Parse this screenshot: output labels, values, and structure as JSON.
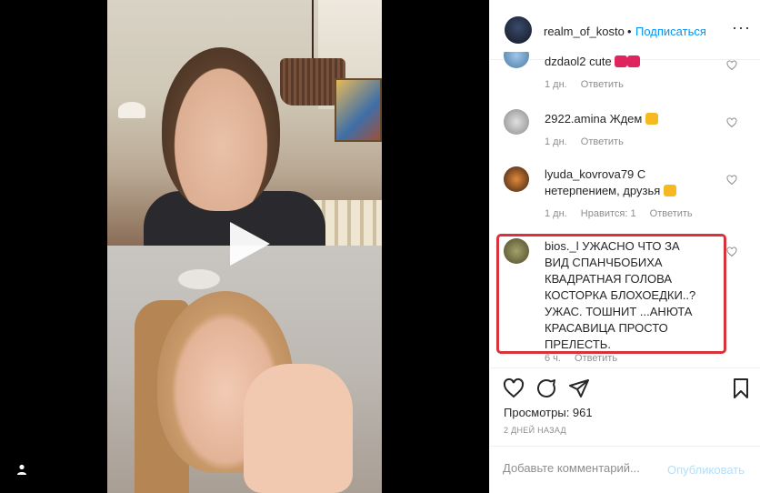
{
  "post": {
    "username": "realm_of_kosto",
    "separator": "•",
    "follow_label": "Подписаться",
    "more_label": "···"
  },
  "comments": [
    {
      "user": "dzdaol2",
      "text": "cute",
      "age": "1 дн.",
      "likes": "",
      "reply": "Ответить",
      "emoji_color": "#e0245e"
    },
    {
      "user": "2922.amina",
      "text": "Ждем",
      "age": "1 дн.",
      "likes": "",
      "reply": "Ответить",
      "emoji_color": "#f5b921"
    },
    {
      "user": "lyuda_kovrova79",
      "text": "С нетерпением, друзья",
      "age": "1 дн.",
      "likes": "Нравится: 1",
      "reply": "Ответить",
      "emoji_color": "#f5b921"
    },
    {
      "user": "bios._l",
      "text": "УЖАСНО ЧТО ЗА ВИД СПАНЧБОБИХА КВАДРАТНАЯ ГОЛОВА КОСТОРКА БЛОХОЕДКИ..? УЖАС. ТОШНИТ ...АНЮТА КРАСАВИЦА ПРОСТО ПРЕЛЕСТЬ.",
      "age": "6 ч.",
      "likes": "",
      "reply": "Ответить"
    }
  ],
  "footer": {
    "views": "Просмотры: 961",
    "date": "2 ДНЕЙ НАЗАД",
    "add_comment_placeholder": "Добавьте комментарий...",
    "publish_label": "Опубликовать"
  },
  "colors": {
    "link": "#0095f6",
    "highlight_border": "#d8333a",
    "meta_text": "#8e8e8e"
  },
  "icons": [
    "play-icon",
    "user-icon",
    "heart-icon",
    "comment-icon",
    "share-icon",
    "bookmark-icon"
  ]
}
